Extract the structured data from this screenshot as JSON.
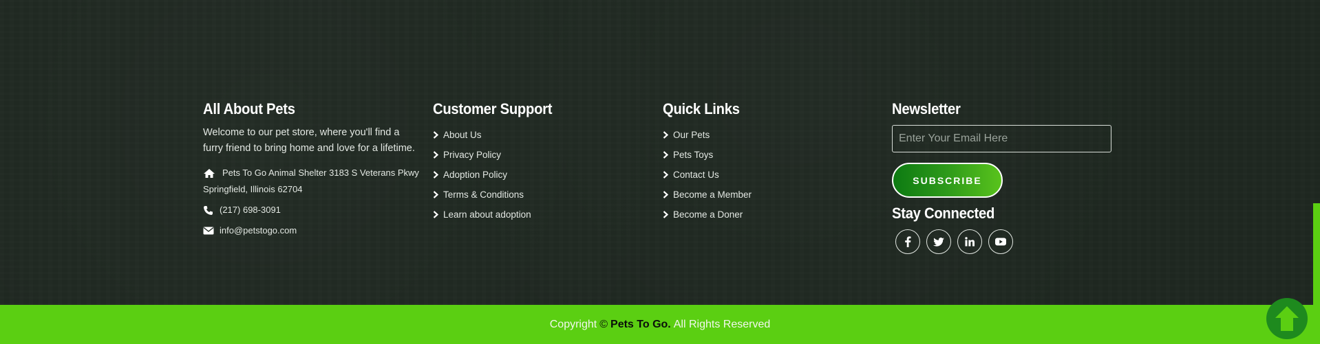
{
  "about": {
    "heading": "All About Pets",
    "text": "Welcome to our pet store, where you'll find a furry friend to bring home and love for a lifetime.",
    "address": "Pets To Go Animal Shelter 3183 S Veterans Pkwy Springfield, Illinois 62704",
    "phone": "(217) 698-3091",
    "email": "info@petstogo.com",
    "icons": [
      "home-icon",
      "phone-icon",
      "envelope-icon"
    ]
  },
  "support": {
    "heading": "Customer Support",
    "links": [
      "About Us",
      "Privacy Policy",
      "Adoption Policy",
      "Terms & Conditions",
      "Learn about adoption"
    ]
  },
  "quick": {
    "heading": "Quick Links",
    "links": [
      "Our Pets",
      "Pets Toys",
      "Contact Us",
      "Become a Member",
      "Become a Doner"
    ]
  },
  "newsletter": {
    "heading": "Newsletter",
    "email_placeholder": "Enter Your Email Here",
    "email_value": "",
    "subscribe_label": "SUBSCRIBE",
    "stay_heading": "Stay Connected",
    "socials": [
      "facebook-icon",
      "twitter-icon",
      "linkedin-icon",
      "youtube-icon"
    ]
  },
  "copyright": {
    "prefix": "Copyright",
    "symbol": "©",
    "brand": "Pets To Go.",
    "suffix": "All Rights Reserved"
  },
  "colors": {
    "background": "#1e2720",
    "accent_green": "#5bcf12",
    "button_dark": "#0d7a12",
    "scroll_button": "#1e8a1e"
  },
  "scroll_top_icon": "arrow-up-icon"
}
